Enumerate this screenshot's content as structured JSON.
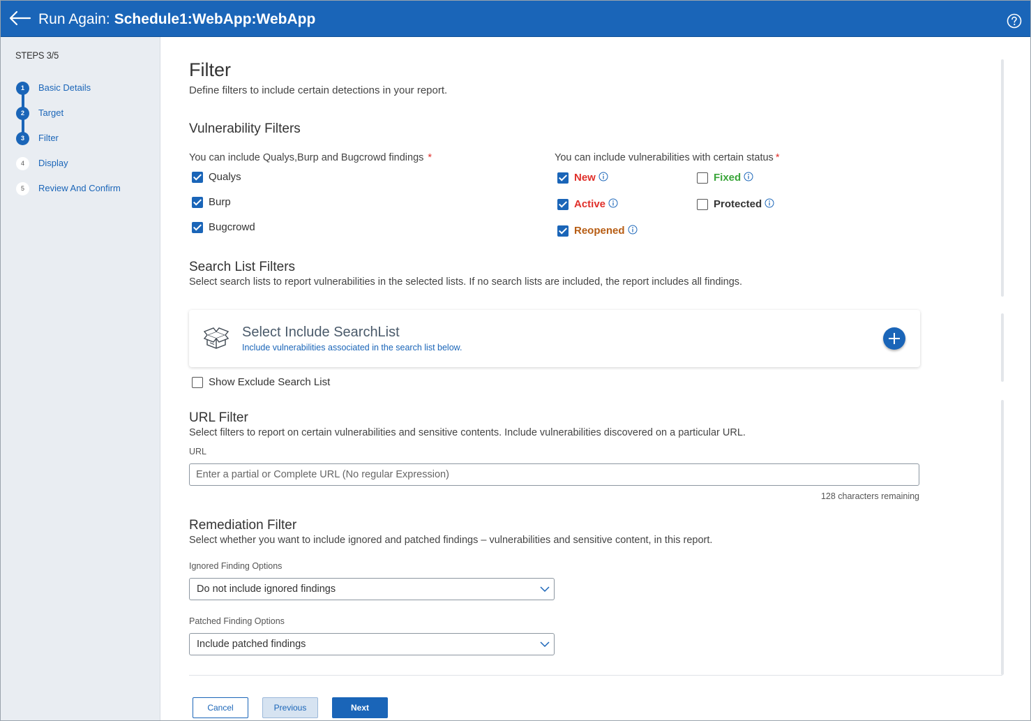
{
  "header": {
    "title_prefix": "Run Again:",
    "title_name": "Schedule1:WebApp:WebApp"
  },
  "sidebar": {
    "steps_label": "STEPS 3/5",
    "steps": [
      {
        "number": "1",
        "label": "Basic Details",
        "state": "done"
      },
      {
        "number": "2",
        "label": "Target",
        "state": "done"
      },
      {
        "number": "3",
        "label": "Filter",
        "state": "current"
      },
      {
        "number": "4",
        "label": "Display",
        "state": "todo"
      },
      {
        "number": "5",
        "label": "Review And Confirm",
        "state": "todo"
      }
    ]
  },
  "page": {
    "title": "Filter",
    "subtitle": "Define filters to include certain detections in your report."
  },
  "vulnerability_filters": {
    "title": "Vulnerability Filters",
    "findings_label": "You can include Qualys,Burp and Bugcrowd findings",
    "required_mark": "*",
    "findings": [
      {
        "label": "Qualys",
        "checked": true
      },
      {
        "label": "Burp",
        "checked": true
      },
      {
        "label": "Bugcrowd",
        "checked": true
      }
    ],
    "status_label": "You can include vulnerabilities with certain status",
    "statuses": [
      {
        "label": "New",
        "checked": true,
        "color": "#e0302b"
      },
      {
        "label": "Active",
        "checked": true,
        "color": "#e0302b"
      },
      {
        "label": "Reopened",
        "checked": true,
        "color": "#b75d14"
      },
      {
        "label": "Fixed",
        "checked": false,
        "color": "#3aa53a"
      },
      {
        "label": "Protected",
        "checked": false,
        "color": "#333333"
      }
    ]
  },
  "search_list_filters": {
    "title": "Search List Filters",
    "description": "Select search lists to report vulnerabilities in the selected lists. If no search lists are included, the report includes all findings.",
    "card_title": "Select Include SearchList",
    "card_subtitle": "Include vulnerabilities associated in the search list below.",
    "show_exclude_label": "Show Exclude Search List",
    "show_exclude_checked": false
  },
  "url_filter": {
    "title": "URL Filter",
    "description": "Select filters to report on certain vulnerabilities and sensitive contents. Include vulnerabilities discovered on a particular URL.",
    "field_label": "URL",
    "placeholder": "Enter a partial or Complete URL (No regular Expression)",
    "value": "",
    "chars_remaining": "128 characters remaining"
  },
  "remediation_filter": {
    "title": "Remediation Filter",
    "description": "Select whether you want to include ignored and patched findings – vulnerabilities and sensitive content, in this report.",
    "ignored_label": "Ignored Finding Options",
    "ignored_value": "Do not include ignored findings",
    "patched_label": "Patched Finding Options",
    "patched_value": "Include patched findings"
  },
  "footer": {
    "cancel_label": "Cancel",
    "previous_label": "Previous",
    "next_label": "Next"
  },
  "colors": {
    "brand_blue": "#1a65b8",
    "required_red": "#e0302b"
  },
  "icons": {
    "back": "arrow-left-icon",
    "help": "question-circle-icon",
    "info": "info-circle-icon",
    "box": "open-box-icon",
    "add": "plus-circle-icon",
    "dropdown": "chevron-down-icon"
  }
}
